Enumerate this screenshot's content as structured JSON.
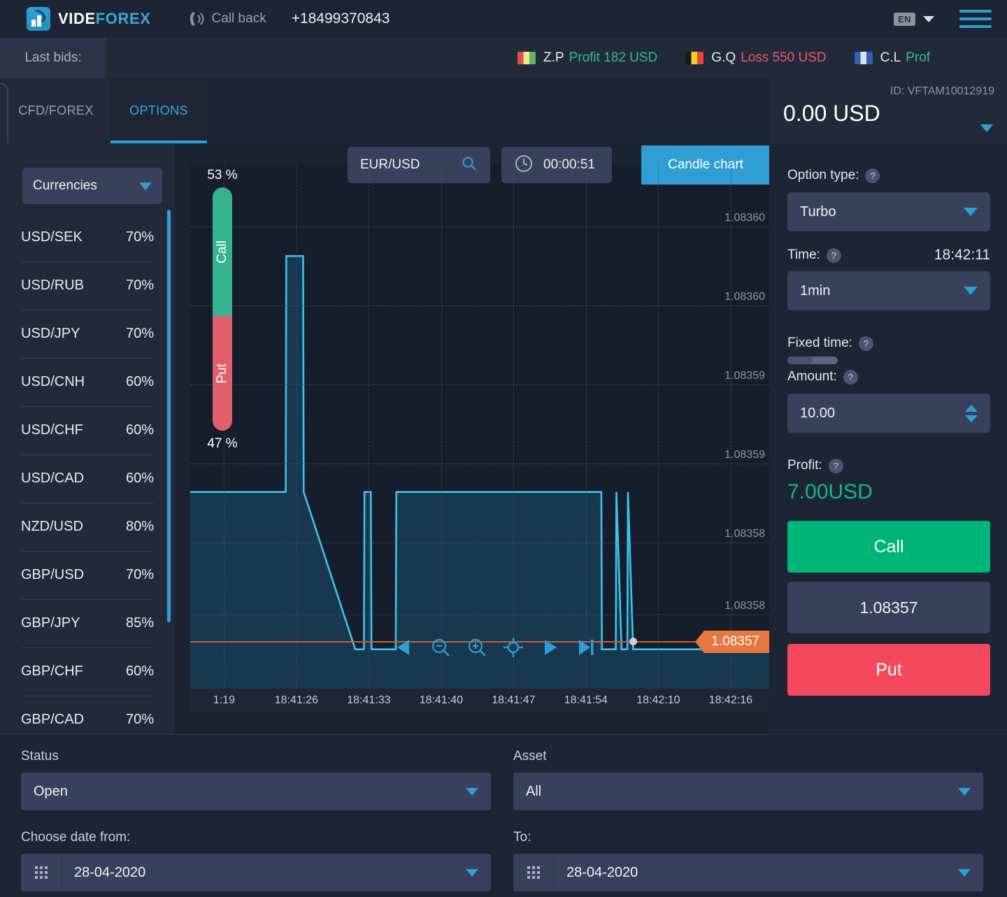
{
  "brand": {
    "name_part1": "VIDE",
    "name_part2": "FOREX"
  },
  "topbar": {
    "callback_label": "Call back",
    "phone": "+18499370843",
    "language": "EN"
  },
  "bids": {
    "label": "Last bids:",
    "items": [
      {
        "user": "Z.P",
        "result": "Profit 182 USD",
        "type": "profit",
        "flag": [
          "#d9534f",
          "#f0e68c",
          "#5cb85c"
        ]
      },
      {
        "user": "G.Q",
        "result": "Loss 550 USD",
        "type": "loss",
        "flag": [
          "#1a1a1a",
          "#f5d020",
          "#e8453c"
        ]
      },
      {
        "user": "C.L",
        "result": "Prof",
        "type": "profit",
        "flag": [
          "#2e5fb5",
          "#d8e0ee",
          "#2e5fb5"
        ]
      }
    ]
  },
  "tabs": [
    {
      "label": "CFD/FOREX",
      "active": false
    },
    {
      "label": "OPTIONS",
      "active": true
    }
  ],
  "account": {
    "id_label": "ID: VFTAM10012919",
    "balance": "0.00 USD"
  },
  "sidebar": {
    "category": "Currencies",
    "pairs": [
      {
        "name": "USD/SEK",
        "payout": "70%"
      },
      {
        "name": "USD/RUB",
        "payout": "70%"
      },
      {
        "name": "USD/JPY",
        "payout": "70%"
      },
      {
        "name": "USD/CNH",
        "payout": "60%"
      },
      {
        "name": "USD/CHF",
        "payout": "60%"
      },
      {
        "name": "USD/CAD",
        "payout": "60%"
      },
      {
        "name": "NZD/USD",
        "payout": "80%"
      },
      {
        "name": "GBP/USD",
        "payout": "70%"
      },
      {
        "name": "GBP/JPY",
        "payout": "85%"
      },
      {
        "name": "GBP/CHF",
        "payout": "60%"
      },
      {
        "name": "GBP/CAD",
        "payout": "70%"
      }
    ]
  },
  "chart_toolbar": {
    "asset": "EUR/USD",
    "timer": "00:00:51",
    "chart_type_button": "Candle chart"
  },
  "sentiment": {
    "call_percent": "53 %",
    "put_percent": "47 %",
    "call_label": "Call",
    "put_label": "Put",
    "call_value": 53,
    "put_value": 47,
    "call_color": "#35b391",
    "put_color": "#e0606a"
  },
  "chart_nav_icons": [
    "step-back-icon",
    "zoom-out-icon",
    "zoom-in-icon",
    "crosshair-icon",
    "play-icon",
    "skip-to-end-icon"
  ],
  "chart_data": {
    "type": "line",
    "title": "EUR/USD",
    "xlabel": "",
    "ylabel": "",
    "ylim": [
      1.083565,
      1.083605
    ],
    "grid": true,
    "legend": false,
    "line_color": "#3dc3f0",
    "fill_color": "rgba(30,100,140,0.38)",
    "current_price": "1.08357",
    "current_price_color": "#e8763f",
    "y_ticks": [
      "1.08360",
      "1.08360",
      "1.08359",
      "1.08359",
      "1.08358",
      "1.08358"
    ],
    "y_tick_positions": [
      0.118,
      0.269,
      0.42,
      0.57,
      0.721,
      0.858
    ],
    "x_ticks": [
      "1:19",
      "18:41:26",
      "18:41:33",
      "18:41:40",
      "18:41:47",
      "18:41:54",
      "18:42:10",
      "18:42:16"
    ],
    "x_tick_positions": [
      0.015,
      0.14,
      0.265,
      0.39,
      0.515,
      0.64,
      0.765,
      0.89
    ],
    "x": [
      0.0,
      0.165,
      0.166,
      0.195,
      0.196,
      0.285,
      0.286,
      0.3,
      0.301,
      0.312,
      0.313,
      0.355,
      0.356,
      0.368,
      0.369,
      0.41,
      0.411,
      0.42,
      0.421,
      0.425,
      0.426,
      0.71,
      0.711,
      0.735,
      0.736,
      0.745,
      0.746,
      0.755,
      0.756,
      0.765,
      0.766,
      0.775,
      0.776,
      0.79,
      0.791,
      0.8,
      0.801,
      0.812,
      0.813,
      1.0
    ],
    "y": [
      1.08358,
      1.08358,
      1.083598,
      1.083598,
      1.08358,
      1.083568,
      1.083568,
      1.083568,
      1.08358,
      1.08358,
      1.083568,
      1.083568,
      1.08358,
      1.08358,
      1.08358,
      1.08358,
      1.08358,
      1.08358,
      1.08358,
      1.08358,
      1.08358,
      1.08358,
      1.083568,
      1.083568,
      1.08358,
      1.083568,
      1.083568,
      1.083568,
      1.08358,
      1.083568,
      1.083568,
      1.083568,
      1.083568,
      1.083568,
      1.083568,
      1.083568,
      1.083568,
      1.083568,
      1.083568,
      1.083568
    ],
    "annotations": [
      {
        "text": "1.08357",
        "kind": "price-marker",
        "color": "#e8763f"
      }
    ]
  },
  "trade": {
    "option_type_label": "Option type:",
    "option_type_value": "Turbo",
    "time_label": "Time:",
    "time_value": "18:42:11",
    "duration_value": "1min",
    "fixed_time_label": "Fixed time:",
    "amount_label": "Amount:",
    "amount_value": "10.00",
    "profit_label": "Profit:",
    "profit_value": "7.00USD",
    "call_button": "Call",
    "strike_price": "1.08357",
    "put_button": "Put",
    "help_glyph": "?"
  },
  "filters": {
    "status_label": "Status",
    "status_value": "Open",
    "asset_label": "Asset",
    "asset_value": "All",
    "date_from_label": "Choose date from:",
    "date_from_value": "28-04-2020",
    "date_to_label": "To:",
    "date_to_value": "28-04-2020"
  }
}
